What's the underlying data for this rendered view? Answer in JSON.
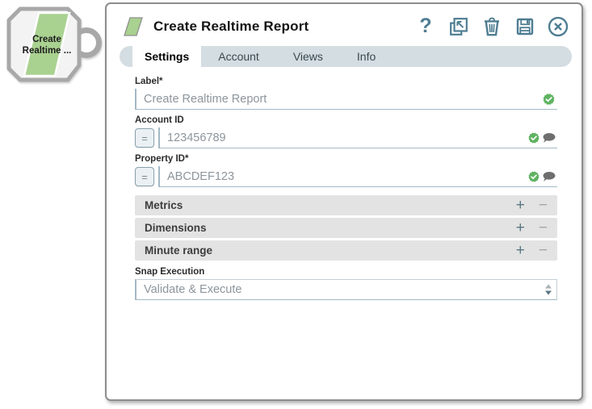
{
  "colors": {
    "icon_teal": "#4f7d92",
    "valid_green": "#5fb360",
    "snap_green": "#a9d190",
    "tab_bar_bg": "#d4dde1"
  },
  "node": {
    "line1": "Create",
    "line2": "Realtime ..."
  },
  "dialog": {
    "title": "Create Realtime Report",
    "help_glyph": "?",
    "header_icons": [
      "help",
      "export",
      "delete",
      "save",
      "close"
    ],
    "tabs": [
      {
        "label": "Settings",
        "active": true
      },
      {
        "label": "Account",
        "active": false
      },
      {
        "label": "Views",
        "active": false
      },
      {
        "label": "Info",
        "active": false
      }
    ]
  },
  "form": {
    "label_field": {
      "label": "Label*",
      "value": "Create Realtime Report",
      "valid": true
    },
    "account_id_field": {
      "label": "Account ID",
      "value": "123456789",
      "expression_glyph": "=",
      "valid": true,
      "has_comment": true
    },
    "property_id_field": {
      "label": "Property ID*",
      "value": "ABCDEF123",
      "expression_glyph": "=",
      "valid": true,
      "has_comment": true
    },
    "sections": [
      {
        "label": "Metrics"
      },
      {
        "label": "Dimensions"
      },
      {
        "label": "Minute range"
      }
    ],
    "expand_glyph": "+",
    "collapse_glyph": "−",
    "snap_execution": {
      "label": "Snap Execution",
      "value": "Validate & Execute"
    }
  }
}
